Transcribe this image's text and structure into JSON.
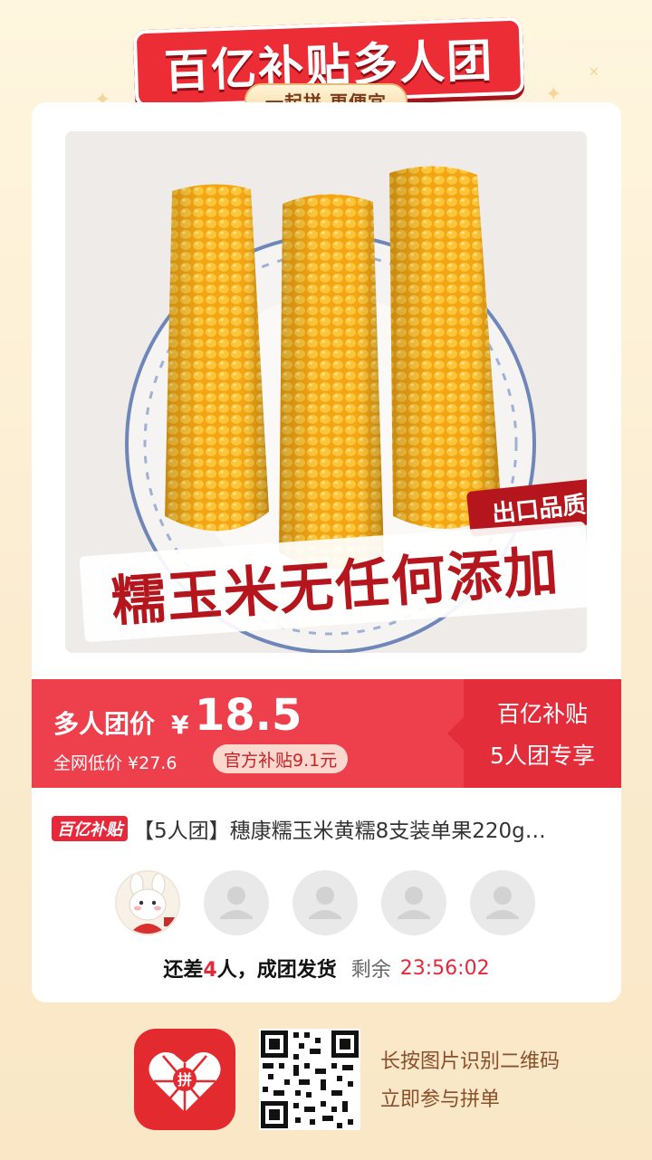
{
  "banner": {
    "title": "百亿补贴多人团",
    "subtitle": "一起拼 更便宜"
  },
  "product": {
    "image_badge": "出口品质",
    "image_headline": "糯玉米无任何添加",
    "title_badge": "百亿补贴",
    "title": "【5人团】穗康糯玉米黄糯8支装单果220g…"
  },
  "price": {
    "group_label": "多人团价",
    "currency": "¥",
    "value": "18.5",
    "lowest_label": "全网低价 ¥27.6",
    "subsidy": "官方补贴9.1元",
    "right_line1": "百亿补贴",
    "right_line2": "5人团专享"
  },
  "group": {
    "status_prefix": "还差",
    "missing_count": "4",
    "status_suffix": "人，成团发货",
    "remain_label": "剩余",
    "countdown": "23:56:02"
  },
  "footer": {
    "line1": "长按图片识别二维码",
    "line2": "立即参与拼单"
  },
  "colors": {
    "accent": "#ee3f4d",
    "accent_dark": "#e32d3b",
    "badge_red": "#b5161d",
    "corn": "#f6b21a"
  }
}
